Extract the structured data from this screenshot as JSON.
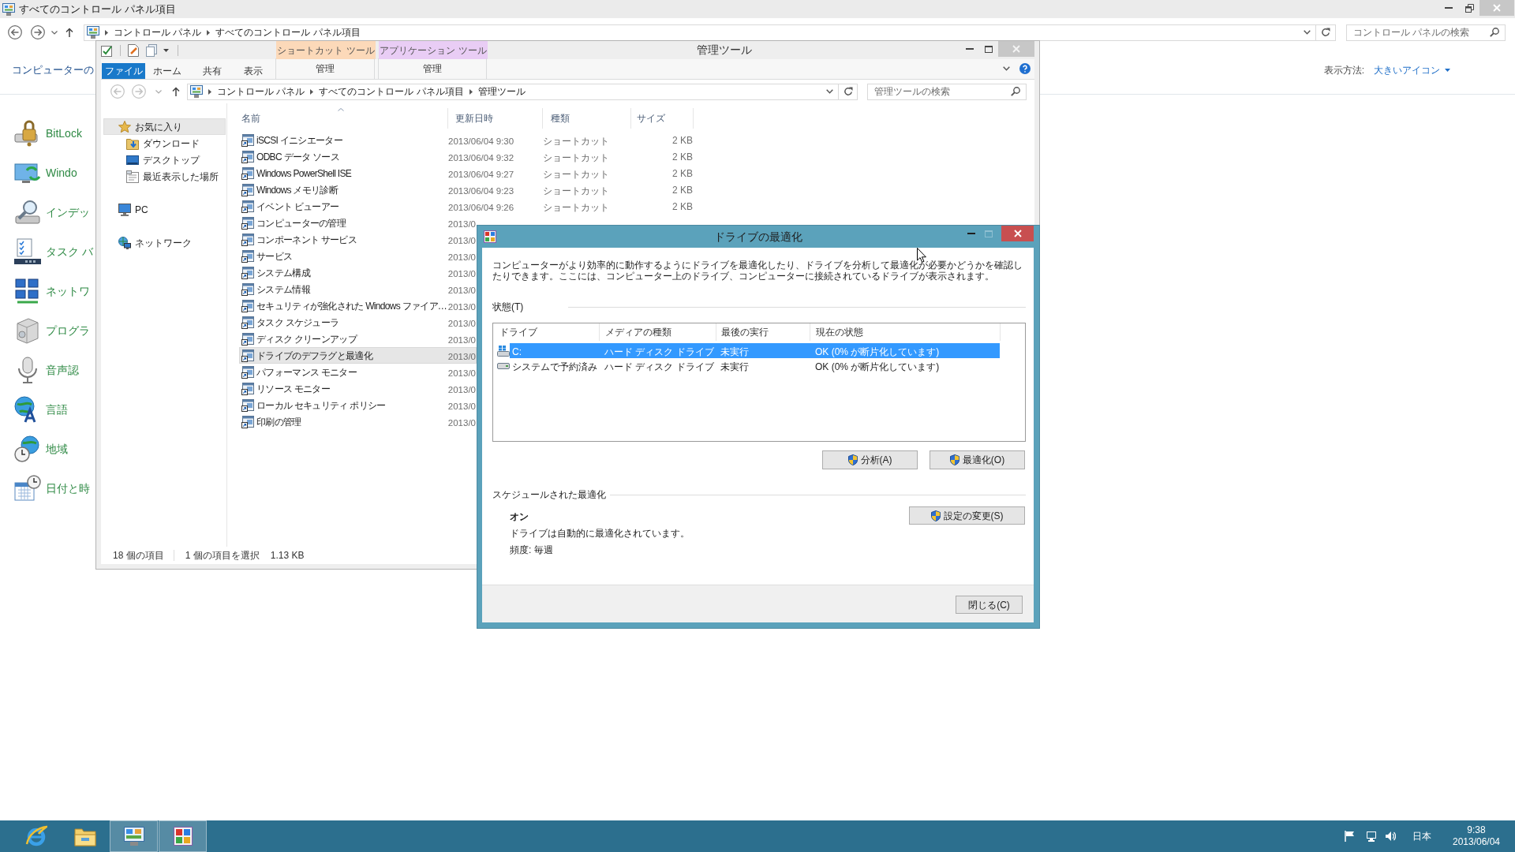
{
  "control_panel": {
    "title": "すべてのコントロール パネル項目",
    "address": [
      {
        "label": "コントロール パネル"
      },
      {
        "label": "すべてのコントロール パネル項目"
      }
    ],
    "search": {
      "placeholder": "コントロール パネルの検索"
    },
    "heading": "コンピューターの",
    "view_label": "表示方法:",
    "view_value": "大きいアイコン",
    "items": [
      {
        "label": "BitLock"
      },
      {
        "label": "Windo"
      },
      {
        "label": "インデッ"
      },
      {
        "label": "タスク バ"
      },
      {
        "label": "ネットワ"
      },
      {
        "label": "プログラ"
      },
      {
        "label": "音声認"
      },
      {
        "label": "言語"
      },
      {
        "label": "地域"
      },
      {
        "label": "日付と時"
      }
    ]
  },
  "explorer": {
    "title": "管理ツール",
    "context_groups": [
      {
        "label": "ショートカット ツール",
        "color": "#fcd9b9",
        "tab": "管理"
      },
      {
        "label": "アプリケーション ツール",
        "color": "#e9cdf5",
        "tab": "管理"
      }
    ],
    "ribbon_tabs": [
      {
        "label": "ファイル",
        "kind": "file"
      },
      {
        "label": "ホーム",
        "kind": "tab"
      },
      {
        "label": "共有",
        "kind": "tab"
      },
      {
        "label": "表示",
        "kind": "tab"
      }
    ],
    "address": [
      {
        "label": "コントロール パネル"
      },
      {
        "label": "すべてのコントロール パネル項目"
      },
      {
        "label": "管理ツール"
      }
    ],
    "search": {
      "placeholder": "管理ツールの検索"
    },
    "nav": [
      {
        "label": "お気に入り",
        "selected": true,
        "children": [
          {
            "label": "ダウンロード",
            "selected": false
          },
          {
            "label": "デスクトップ",
            "selected": false
          },
          {
            "label": "最近表示した場所",
            "selected": false
          }
        ]
      },
      {
        "label": "PC",
        "selected": false
      },
      {
        "label": "ネットワーク",
        "selected": false
      }
    ],
    "columns": [
      "名前",
      "更新日時",
      "種類",
      "サイズ"
    ],
    "rows": [
      {
        "name": "iSCSI イニシエーター",
        "date": "2013/06/04 9:30",
        "type": "ショートカット",
        "size": "2 KB",
        "selected": false
      },
      {
        "name": "ODBC データ ソース",
        "date": "2013/06/04 9:32",
        "type": "ショートカット",
        "size": "2 KB",
        "selected": false
      },
      {
        "name": "Windows PowerShell ISE",
        "date": "2013/06/04 9:27",
        "type": "ショートカット",
        "size": "2 KB",
        "selected": false
      },
      {
        "name": "Windows メモリ診断",
        "date": "2013/06/04 9:23",
        "type": "ショートカット",
        "size": "2 KB",
        "selected": false
      },
      {
        "name": "イベント ビューアー",
        "date": "2013/06/04 9:26",
        "type": "ショートカット",
        "size": "2 KB",
        "selected": false
      },
      {
        "name": "コンピューターの管理",
        "date": "2013/0",
        "selected": false
      },
      {
        "name": "コンポーネント サービス",
        "date": "2013/0",
        "selected": false
      },
      {
        "name": "サービス",
        "date": "2013/0",
        "selected": false
      },
      {
        "name": "システム構成",
        "date": "2013/0",
        "selected": false
      },
      {
        "name": "システム情報",
        "date": "2013/0",
        "selected": false
      },
      {
        "name": "セキュリティが強化された Windows ファイア…",
        "date": "2013/0",
        "selected": false
      },
      {
        "name": "タスク スケジューラ",
        "date": "2013/0",
        "selected": false
      },
      {
        "name": "ディスク クリーンアップ",
        "date": "2013/0",
        "selected": false
      },
      {
        "name": "ドライブのデフラグと最適化",
        "date": "2013/0",
        "selected": true
      },
      {
        "name": "パフォーマンス モニター",
        "date": "2013/0",
        "selected": false
      },
      {
        "name": "リソース モニター",
        "date": "2013/0",
        "selected": false
      },
      {
        "name": "ローカル セキュリティ ポリシー",
        "date": "2013/0",
        "selected": false
      },
      {
        "name": "印刷の管理",
        "date": "2013/0",
        "selected": false
      }
    ],
    "status": {
      "count": "18 個の項目",
      "selection": "1 個の項目を選択",
      "size": "1.13 KB"
    }
  },
  "dialog": {
    "title": "ドライブの最適化",
    "description": "コンピューターがより効率的に動作するようにドライブを最適化したり、ドライブを分析して最適化が必要かどうかを確認したりできます。ここには、コンピューター上のドライブ、コンピューターに接続されているドライブが表示されます。",
    "status_label": "状態(T)",
    "columns": [
      "ドライブ",
      "メディアの種類",
      "最後の実行",
      "現在の状態"
    ],
    "drives": [
      {
        "kind": "system",
        "name": "C:",
        "media": "ハード ディスク ドライブ",
        "last_run": "未実行",
        "status": "OK (0% が断片化しています)",
        "selected": true
      },
      {
        "kind": "volume",
        "name": "システムで予約済み",
        "media": "ハード ディスク ドライブ",
        "last_run": "未実行",
        "status": "OK (0% が断片化しています)",
        "selected": false
      }
    ],
    "actions": [
      {
        "label": "分析(A)"
      },
      {
        "label": "最適化(O)"
      }
    ],
    "schedule_label": "スケジュールされた最適化",
    "schedule": {
      "state": "オン",
      "detail": "ドライブは自動的に最適化されています。",
      "frequency": "頻度: 毎週"
    },
    "settings_button": "設定の変更(S)",
    "close_button": "閉じる(C)"
  },
  "taskbar": {
    "apps": [
      {
        "active": false
      },
      {
        "active": false
      },
      {
        "active": true
      },
      {
        "active": true
      }
    ],
    "language": "日本",
    "time": "9:38",
    "date": "2013/06/04"
  }
}
